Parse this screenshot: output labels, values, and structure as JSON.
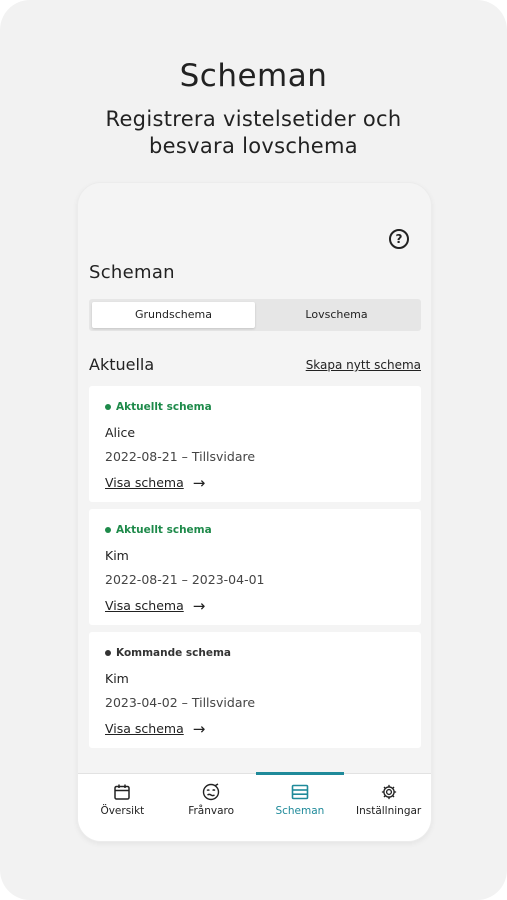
{
  "promo": {
    "title": "Scheman",
    "subtitle_line1": "Registrera vistelsetider och",
    "subtitle_line2": "besvara lovschema"
  },
  "screen": {
    "title": "Scheman",
    "help_icon": "help-circle-icon",
    "tabs": [
      "Grundschema",
      "Lovschema"
    ],
    "active_tab": "Grundschema",
    "section_label": "Aktuella",
    "create_link": "Skapa nytt schema"
  },
  "schedules": [
    {
      "status": "Aktuellt schema",
      "status_color": "#1e8a4a",
      "name": "Alice",
      "dates": "2022-08-21 – Tillsvidare",
      "link": "Visa schema"
    },
    {
      "status": "Aktuellt schema",
      "status_color": "#1e8a4a",
      "name": "Kim",
      "dates": "2022-08-21 – 2023-04-01",
      "link": "Visa schema"
    },
    {
      "status": "Kommande schema",
      "status_color": "#333333",
      "name": "Kim",
      "dates": "2023-04-02 – Tillsvidare",
      "link": "Visa schema"
    }
  ],
  "bottom_nav": [
    {
      "label": "Översikt",
      "icon": "calendar-icon"
    },
    {
      "label": "Frånvaro",
      "icon": "sick-face-icon"
    },
    {
      "label": "Scheman",
      "icon": "schedule-list-icon",
      "active": true
    },
    {
      "label": "Inställningar",
      "icon": "gear-icon"
    }
  ],
  "colors": {
    "accent": "#1f8a9a",
    "current_status": "#1e8a4a",
    "upcoming_status": "#333333"
  }
}
